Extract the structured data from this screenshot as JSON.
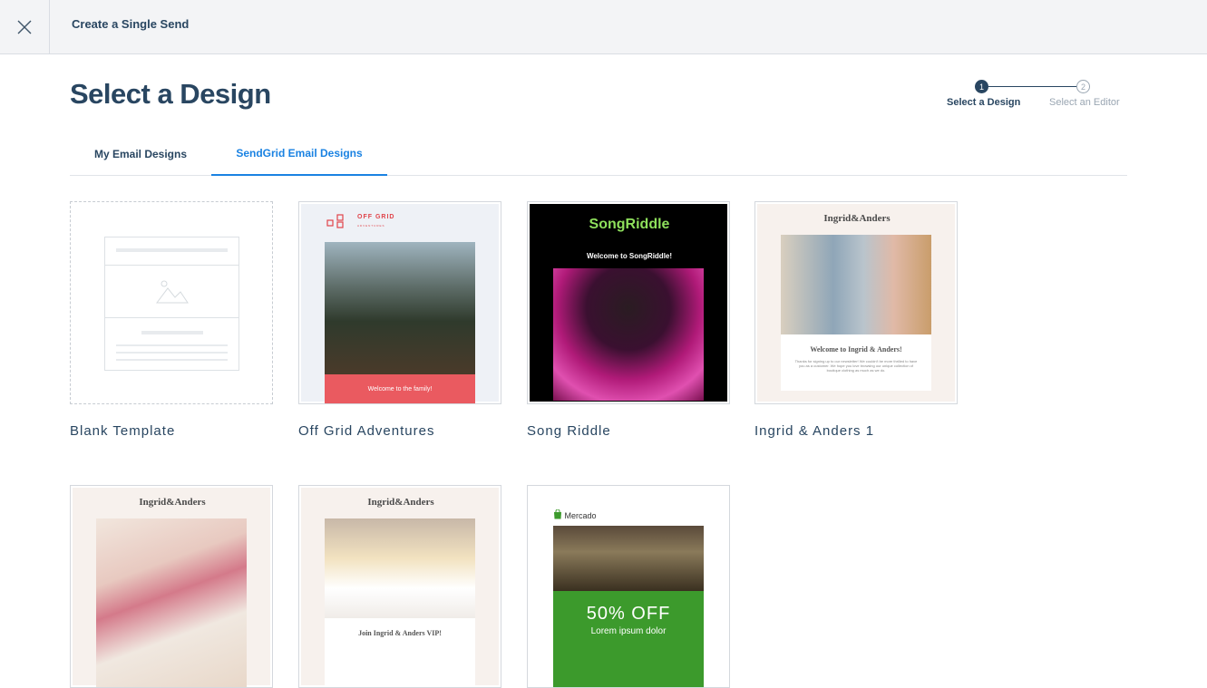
{
  "topbar": {
    "close_icon": "close-icon",
    "title": "Create a Single Send"
  },
  "page": {
    "title": "Select a Design"
  },
  "stepper": {
    "steps": [
      {
        "number": "1",
        "label": "Select a Design",
        "active": true
      },
      {
        "number": "2",
        "label": "Select an Editor",
        "active": false
      }
    ]
  },
  "tabs": [
    {
      "label": "My Email Designs",
      "active": false
    },
    {
      "label": "SendGrid Email Designs",
      "active": true
    }
  ],
  "designs": [
    {
      "label": "Blank Template"
    },
    {
      "label": "Off Grid Adventures",
      "thumb_logo": "OFF GRID",
      "thumb_logo_sub": "ADVENTURES",
      "thumb_banner": "Welcome to the family!"
    },
    {
      "label": "Song Riddle",
      "thumb_logo": "SongRiddle",
      "thumb_welcome": "Welcome to SongRiddle!"
    },
    {
      "label": "Ingrid & Anders 1",
      "thumb_logo": "Ingrid&Anders",
      "thumb_title": "Welcome to Ingrid & Anders!",
      "thumb_body": "Thanks for signing up to our newsletter! We couldn't be more thrilled to have you as a customer. We hope you love browsing our unique collection of boutique clothing as much as we do."
    },
    {
      "label": "",
      "thumb_logo": "Ingrid&Anders"
    },
    {
      "label": "",
      "thumb_logo": "Ingrid&Anders",
      "thumb_title": "Join Ingrid & Anders VIP!"
    },
    {
      "label": "",
      "thumb_logo": "Mercado",
      "thumb_offer": "50% OFF",
      "thumb_lorem": "Lorem ipsum dolor"
    }
  ],
  "colors": {
    "navy": "#294661",
    "accent_blue": "#1a82e2"
  }
}
